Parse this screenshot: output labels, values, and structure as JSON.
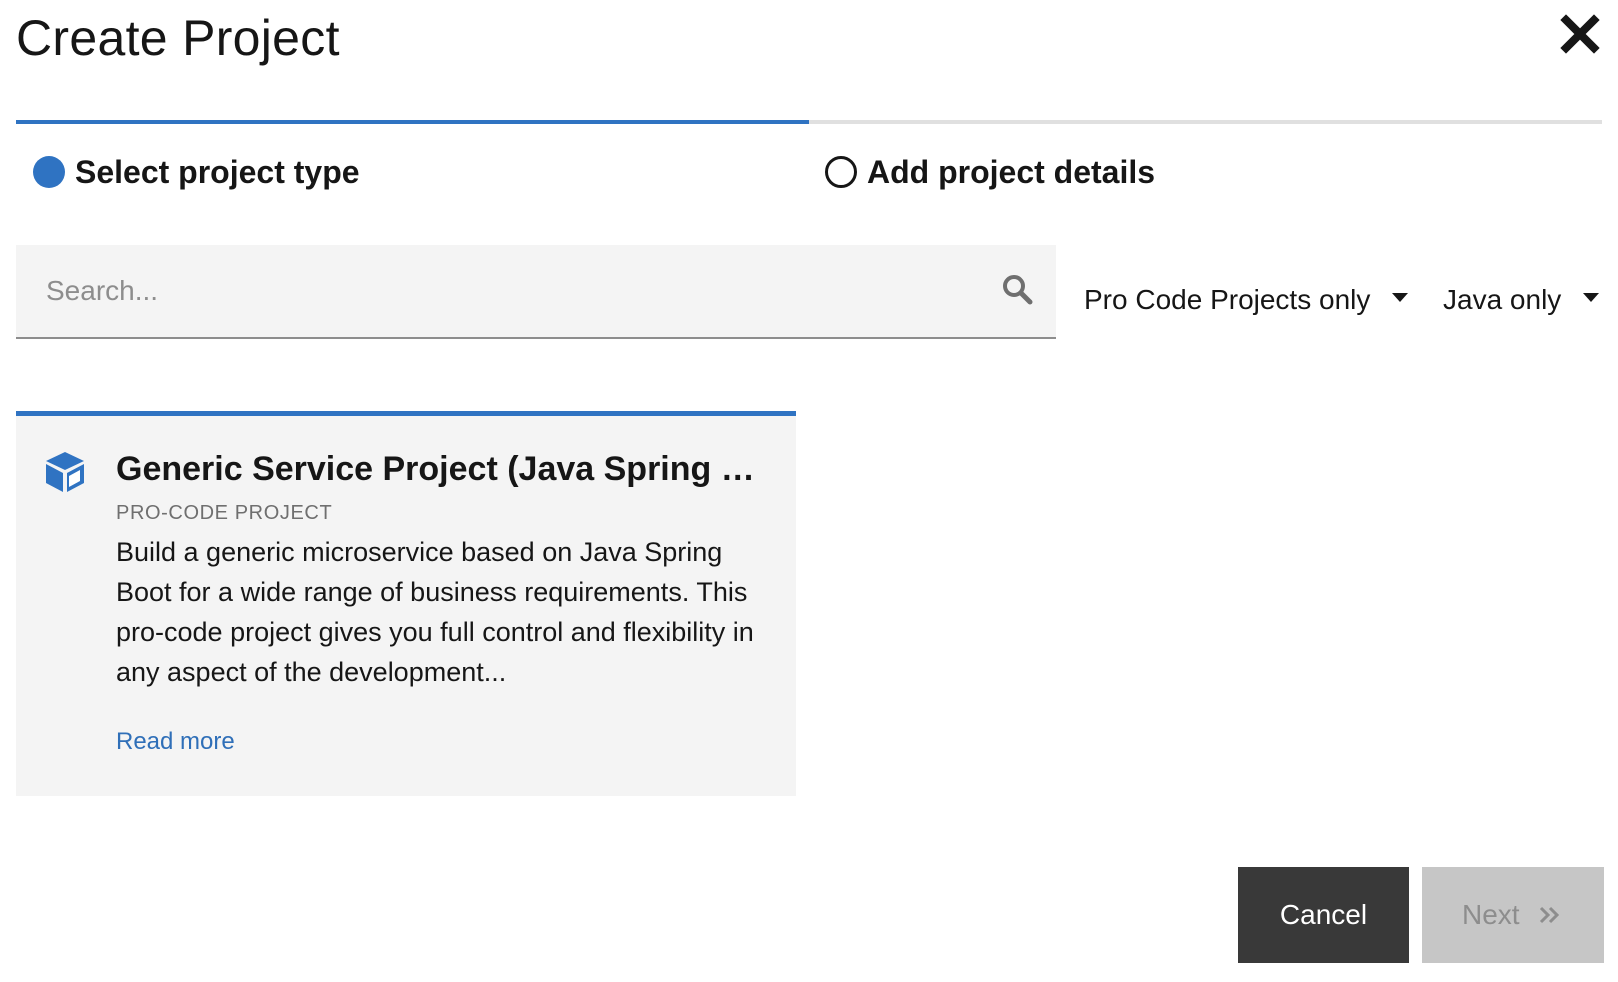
{
  "dialog": {
    "title": "Create Project",
    "close_icon": "close-icon"
  },
  "stepper": {
    "progress_fraction": 0.5,
    "steps": [
      {
        "label": "Select project type",
        "state": "active"
      },
      {
        "label": "Add project details",
        "state": "inactive"
      }
    ]
  },
  "search": {
    "placeholder": "Search...",
    "value": "",
    "icon": "search-icon"
  },
  "filters": [
    {
      "label": "Pro Code Projects only",
      "icon": "caret-down-icon"
    },
    {
      "label": "Java only",
      "icon": "caret-down-icon"
    }
  ],
  "cards": [
    {
      "icon": "cube-icon",
      "title": "Generic Service Project (Java Spring Boot)",
      "type": "PRO-CODE PROJECT",
      "description": "Build a generic microservice based on Java Spring Boot for a wide range of business requirements. This pro-code project gives you full control and flexibility in any aspect of the development...",
      "link": "Read more"
    }
  ],
  "footer": {
    "cancel_label": "Cancel",
    "next_label": "Next",
    "next_icon": "double-chevron-right-icon"
  },
  "colors": {
    "accent": "#2f73c2",
    "cancel_bg": "#393939",
    "disabled_bg": "#c6c6c6",
    "field_bg": "#f4f4f4"
  }
}
